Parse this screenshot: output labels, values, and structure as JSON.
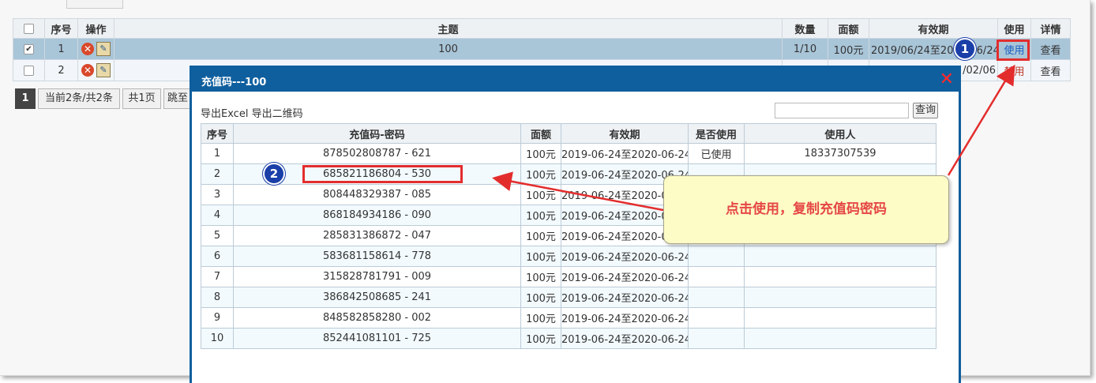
{
  "grid": {
    "headers": [
      "",
      "序号",
      "操作",
      "主题",
      "数量",
      "面额",
      "有效期",
      "使用",
      "详情"
    ],
    "rows": [
      {
        "index": "1",
        "checked": true,
        "subject": "100",
        "qty": "1/10",
        "denom": "100元",
        "validity": "2019/06/24至2020/06/24",
        "use": "使用",
        "detail": "查看"
      },
      {
        "index": "2",
        "checked": false,
        "subject": "",
        "qty": "",
        "denom": "",
        "validity": "/02/06",
        "use": "禁用",
        "detail": "查看"
      }
    ]
  },
  "pager": {
    "current": "1",
    "summary": "当前2条/共2条",
    "pages": "共1页",
    "jump": "跳至"
  },
  "dialog": {
    "title": "充值码---100",
    "export_excel": "导出Excel",
    "export_qr": "导出二维码",
    "search_placeholder": "",
    "query_button": "查询",
    "headers": [
      "序号",
      "充值码-密码",
      "面额",
      "有效期",
      "是否使用",
      "使用人"
    ],
    "rows": [
      {
        "no": "1",
        "code": "878502808787 - 621",
        "denom": "100元",
        "validity": "2019-06-24至2020-06-24",
        "used": "已使用",
        "user": "18337307539"
      },
      {
        "no": "2",
        "code": "685821186804 - 530",
        "denom": "100元",
        "validity": "2019-06-24至2020-06-24",
        "used": "",
        "user": ""
      },
      {
        "no": "3",
        "code": "808448329387 - 085",
        "denom": "100元",
        "validity": "2019-06-24至2020-06-24",
        "used": "",
        "user": ""
      },
      {
        "no": "4",
        "code": "868184934186 - 090",
        "denom": "100元",
        "validity": "2019-06-24至2020-06-24",
        "used": "",
        "user": ""
      },
      {
        "no": "5",
        "code": "285831386872 - 047",
        "denom": "100元",
        "validity": "2019-06-24至2020-06-24",
        "used": "",
        "user": ""
      },
      {
        "no": "6",
        "code": "583681158614 - 778",
        "denom": "100元",
        "validity": "2019-06-24至2020-06-24",
        "used": "",
        "user": ""
      },
      {
        "no": "7",
        "code": "315828781791 - 009",
        "denom": "100元",
        "validity": "2019-06-24至2020-06-24",
        "used": "",
        "user": ""
      },
      {
        "no": "8",
        "code": "386842508685 - 241",
        "denom": "100元",
        "validity": "2019-06-24至2020-06-24",
        "used": "",
        "user": ""
      },
      {
        "no": "9",
        "code": "848582858280 - 002",
        "denom": "100元",
        "validity": "2019-06-24至2020-06-24",
        "used": "",
        "user": ""
      },
      {
        "no": "10",
        "code": "852441081101 - 725",
        "denom": "100元",
        "validity": "2019-06-24至2020-06-24",
        "used": "",
        "user": ""
      }
    ]
  },
  "annotations": {
    "step1": "1",
    "step2": "2",
    "callout": "点击使用，复制充值码密码",
    "accent_color": "#e32d2d",
    "badge_color": "#1a3fa8"
  },
  "icons": {
    "delete": "delete-icon",
    "edit": "edit-icon",
    "close": "close-icon"
  }
}
